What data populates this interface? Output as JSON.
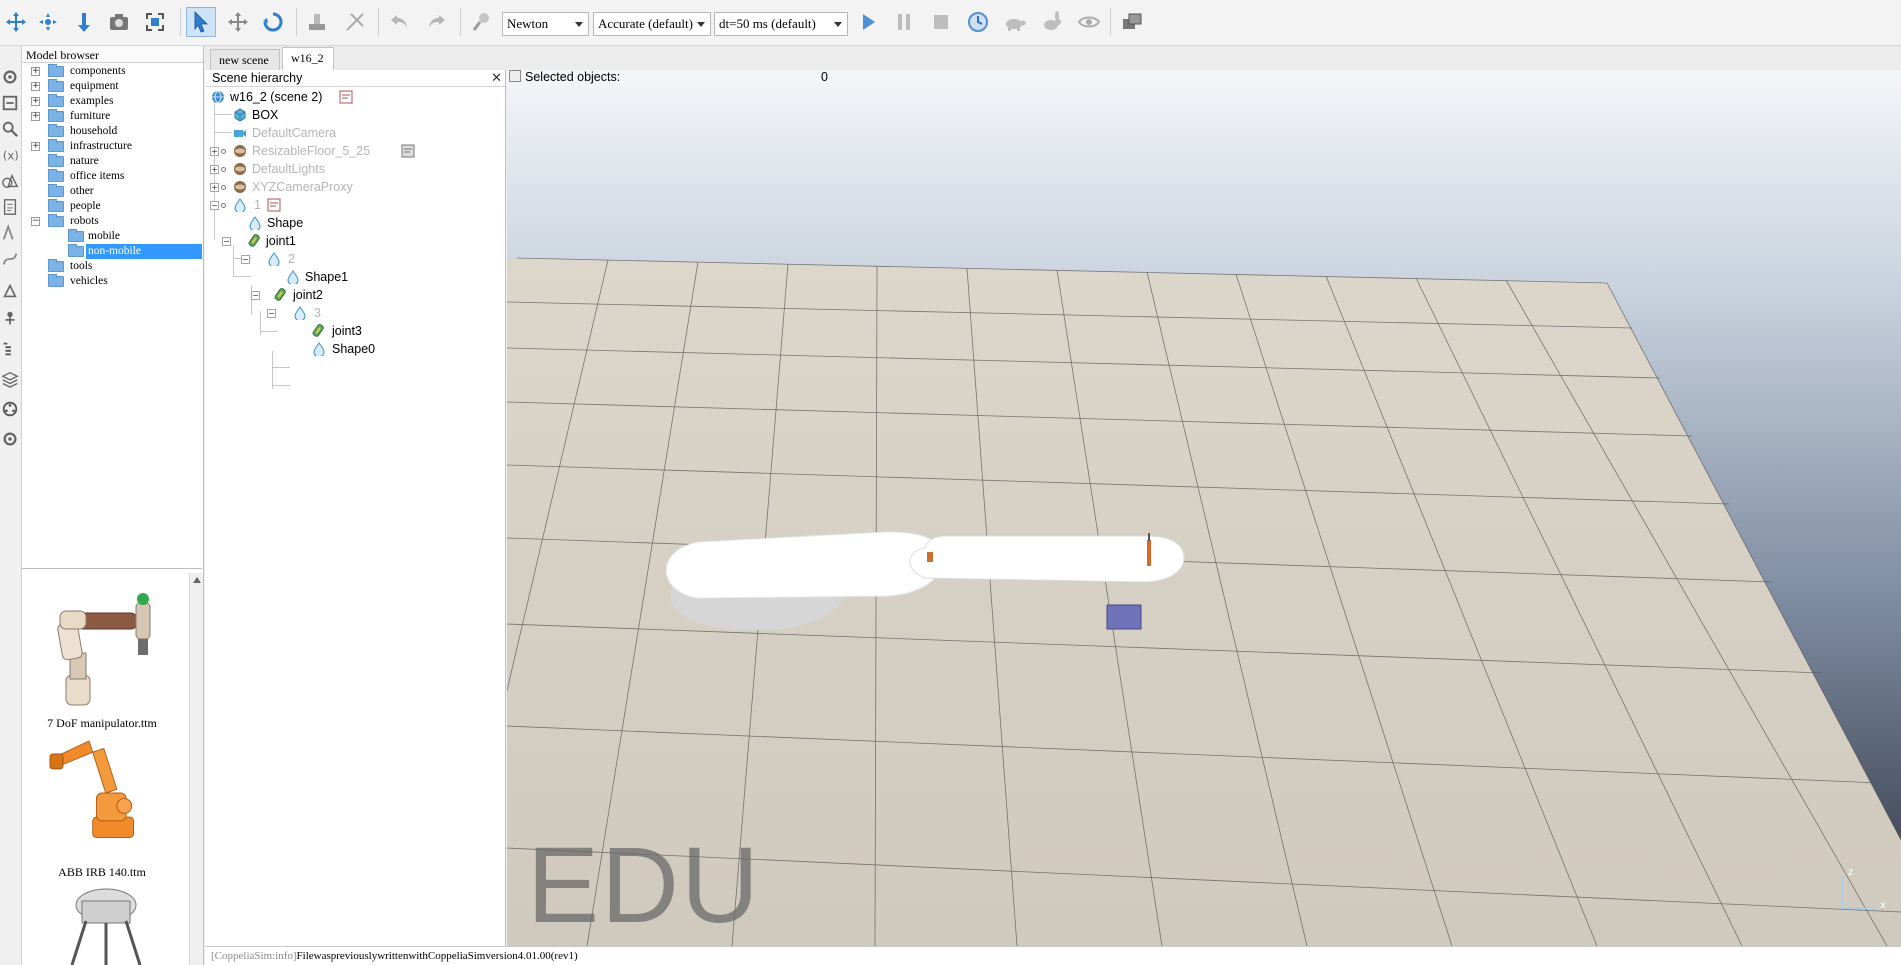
{
  "toolbar": {
    "engine": "Newton",
    "accuracy": "Accurate (default)",
    "timestep": "dt=50 ms (default)"
  },
  "model_browser": {
    "title": "Model browser",
    "folders": [
      {
        "label": "components",
        "expandable": true
      },
      {
        "label": "equipment",
        "expandable": true
      },
      {
        "label": "examples",
        "expandable": true
      },
      {
        "label": "furniture",
        "expandable": true
      },
      {
        "label": "household",
        "expandable": false
      },
      {
        "label": "infrastructure",
        "expandable": true
      },
      {
        "label": "nature",
        "expandable": false
      },
      {
        "label": "office items",
        "expandable": false
      },
      {
        "label": "other",
        "expandable": false
      },
      {
        "label": "people",
        "expandable": false
      },
      {
        "label": "robots",
        "expandable": true,
        "expanded": true
      },
      {
        "label": "mobile",
        "child": true
      },
      {
        "label": "non-mobile",
        "child": true,
        "selected": true
      },
      {
        "label": "tools",
        "expandable": false
      },
      {
        "label": "vehicles",
        "expandable": false
      }
    ],
    "thumbnails": [
      {
        "label": "7 DoF manipulator.ttm"
      },
      {
        "label": "ABB IRB 140.ttm"
      }
    ]
  },
  "tabs": [
    "new scene",
    "w16_2"
  ],
  "hierarchy": {
    "title": "Scene hierarchy",
    "close": "✕",
    "items": [
      {
        "label": "w16_2 (scene 2)",
        "icon": "globe-icon"
      },
      {
        "label": "BOX",
        "icon": "cube-icon"
      },
      {
        "label": "DefaultCamera",
        "icon": "camera-icon",
        "dim": true
      },
      {
        "label": "ResizableFloor_5_25",
        "icon": "floor-icon",
        "dim": true
      },
      {
        "label": "DefaultLights",
        "icon": "light-icon",
        "dim": true
      },
      {
        "label": "XYZCameraProxy",
        "icon": "proxy-icon",
        "dim": true
      },
      {
        "label": "1",
        "icon": "shape-icon",
        "dim": true
      },
      {
        "label": "Shape",
        "icon": "shape-icon"
      },
      {
        "label": "joint1",
        "icon": "joint-icon"
      },
      {
        "label": "2",
        "icon": "shape-icon",
        "dim": true
      },
      {
        "label": "Shape1",
        "icon": "shape-icon"
      },
      {
        "label": "joint2",
        "icon": "joint-icon"
      },
      {
        "label": "3",
        "icon": "shape-icon",
        "dim": true
      },
      {
        "label": "joint3",
        "icon": "joint-icon"
      },
      {
        "label": "Shape0",
        "icon": "shape-icon"
      }
    ]
  },
  "viewport": {
    "selected_label": "Selected objects:",
    "selected_count": "0",
    "watermark": "EDU",
    "axis_z": "z",
    "axis_x": "x"
  },
  "status": {
    "prefix": "[CoppeliaSim:info]",
    "message": "FilewaspreviouslywrittenwithCoppeliaSimversion4.01.00(rev1)"
  }
}
